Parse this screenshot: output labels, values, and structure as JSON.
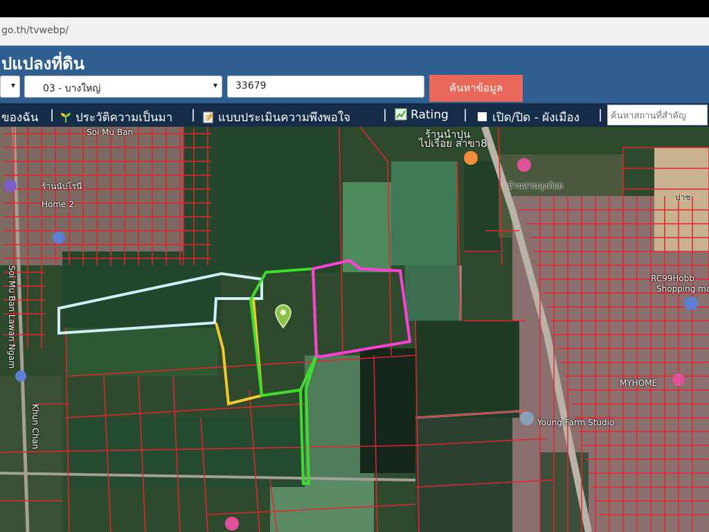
{
  "browser": {
    "url": "go.th/tvwebp/"
  },
  "header": {
    "title": "ปแปลงที่ดิน"
  },
  "search": {
    "province_arrow": "▾",
    "district_value": "03 - บางใหญ่",
    "district_arrow": "▾",
    "parcel_value": "33679",
    "button_label": "ค้นหาข้อมูล"
  },
  "nav": {
    "items": [
      {
        "label": "ของฉัน"
      },
      {
        "label": "ประวัติความเป็นมา"
      },
      {
        "label": "แบบประเมินความพึงพอใจ"
      },
      {
        "label": "Rating"
      },
      {
        "label": "เปิด/ปิด - ผังเมือง"
      }
    ],
    "separator": "|",
    "search_placeholder": "ค้นหาสถานที่สำคัญ"
  },
  "map": {
    "labels": [
      {
        "text": "Soi Mu Ban"
      },
      {
        "text": "ร้านนัปโรนี"
      },
      {
        "text": "Home 2"
      },
      {
        "text": "Soi Mu Ban Lawan Ngam"
      },
      {
        "text": "ร้านนำปุน"
      },
      {
        "text": "ไปเรือย สาขา8"
      },
      {
        "text": "บ้านสวนลุงต้อย"
      },
      {
        "text": "ปาช"
      },
      {
        "text": "RC99Hobb"
      },
      {
        "text": "Shopping ma"
      },
      {
        "text": "Young Farm Studio"
      },
      {
        "text": "MYHOME"
      },
      {
        "text": "Khun Chan"
      }
    ],
    "colors": {
      "parcel_border": "#e8232f",
      "highlight_white": "#cfeff7",
      "highlight_green": "#3fdc2f",
      "highlight_magenta": "#ff3fd8",
      "highlight_yellow": "#f2c832",
      "field": "#244a30",
      "pin": "#8bc34a"
    }
  }
}
